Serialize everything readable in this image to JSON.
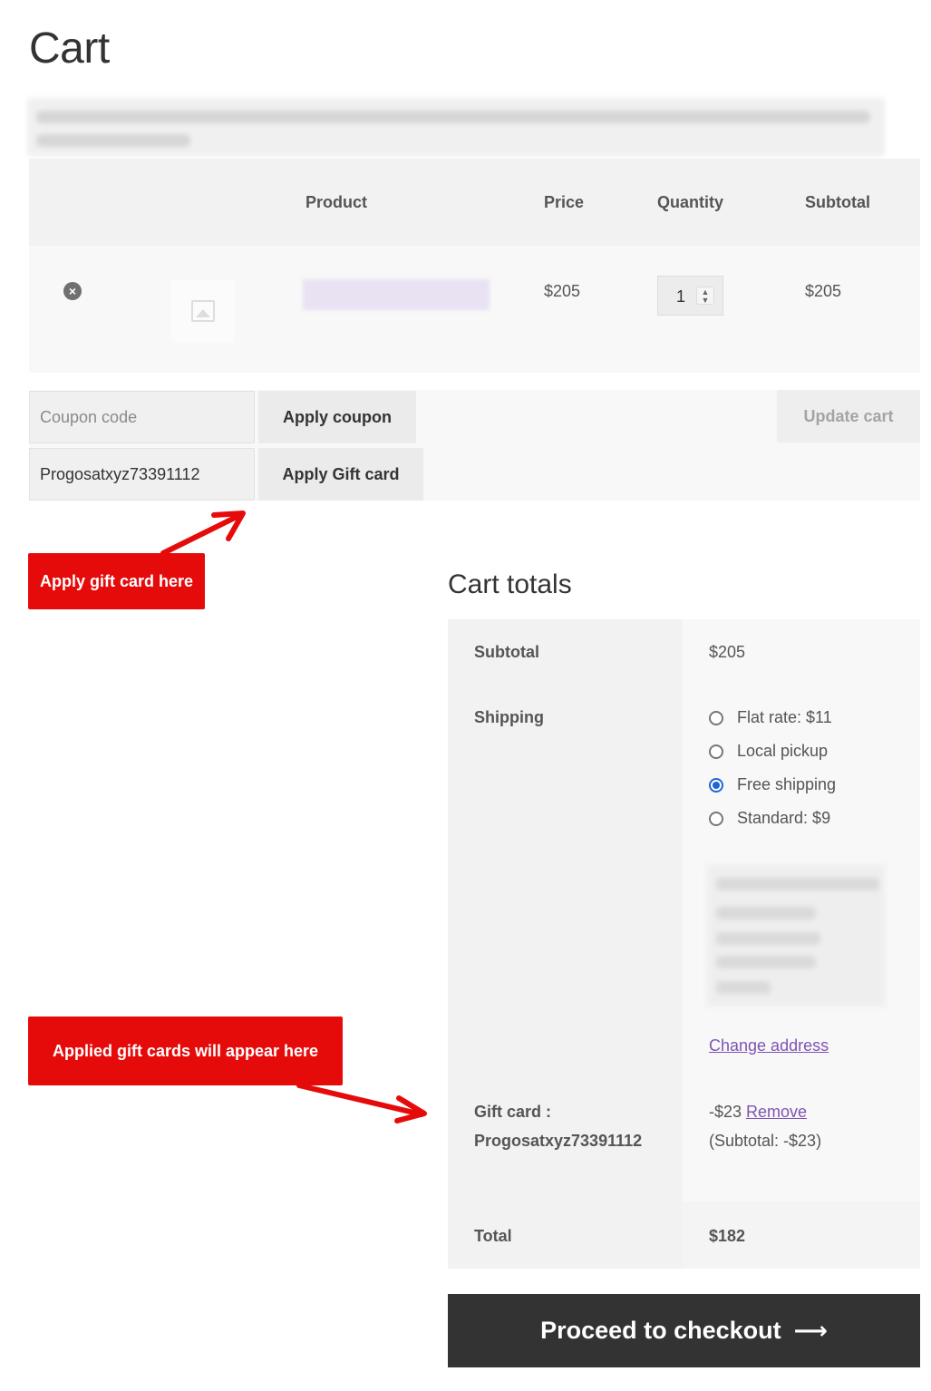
{
  "page": {
    "title": "Cart"
  },
  "cart_table": {
    "headers": {
      "product": "Product",
      "price": "Price",
      "quantity": "Quantity",
      "subtotal": "Subtotal"
    },
    "rows": [
      {
        "price": "$205",
        "quantity": "1",
        "subtotal": "$205"
      }
    ]
  },
  "actions": {
    "coupon_placeholder": "Coupon code",
    "apply_coupon": "Apply coupon",
    "update_cart": "Update cart",
    "gift_card_value": "Progosatxyz73391112",
    "apply_gift_card": "Apply Gift card"
  },
  "annotations": {
    "apply_here": "Apply gift card here",
    "applied_here": "Applied gift cards will appear here",
    "color": "#e60b0b"
  },
  "totals": {
    "title": "Cart totals",
    "subtotal_label": "Subtotal",
    "subtotal_value": "$205",
    "shipping_label": "Shipping",
    "shipping_options": [
      {
        "label": "Flat rate: $11",
        "checked": false
      },
      {
        "label": "Local pickup",
        "checked": false
      },
      {
        "label": "Free shipping",
        "checked": true
      },
      {
        "label": "Standard: $9",
        "checked": false
      }
    ],
    "change_address": "Change address",
    "gift_card_label": "Gift card :",
    "gift_card_code": "Progosatxyz73391112",
    "gift_card_amount": "-$23",
    "gift_card_remove": "Remove",
    "gift_card_subtotal": "(Subtotal: -$23)",
    "total_label": "Total",
    "total_value": "$182"
  },
  "checkout": {
    "label": "Proceed to checkout",
    "arrow_icon": "arrow-right-icon"
  }
}
